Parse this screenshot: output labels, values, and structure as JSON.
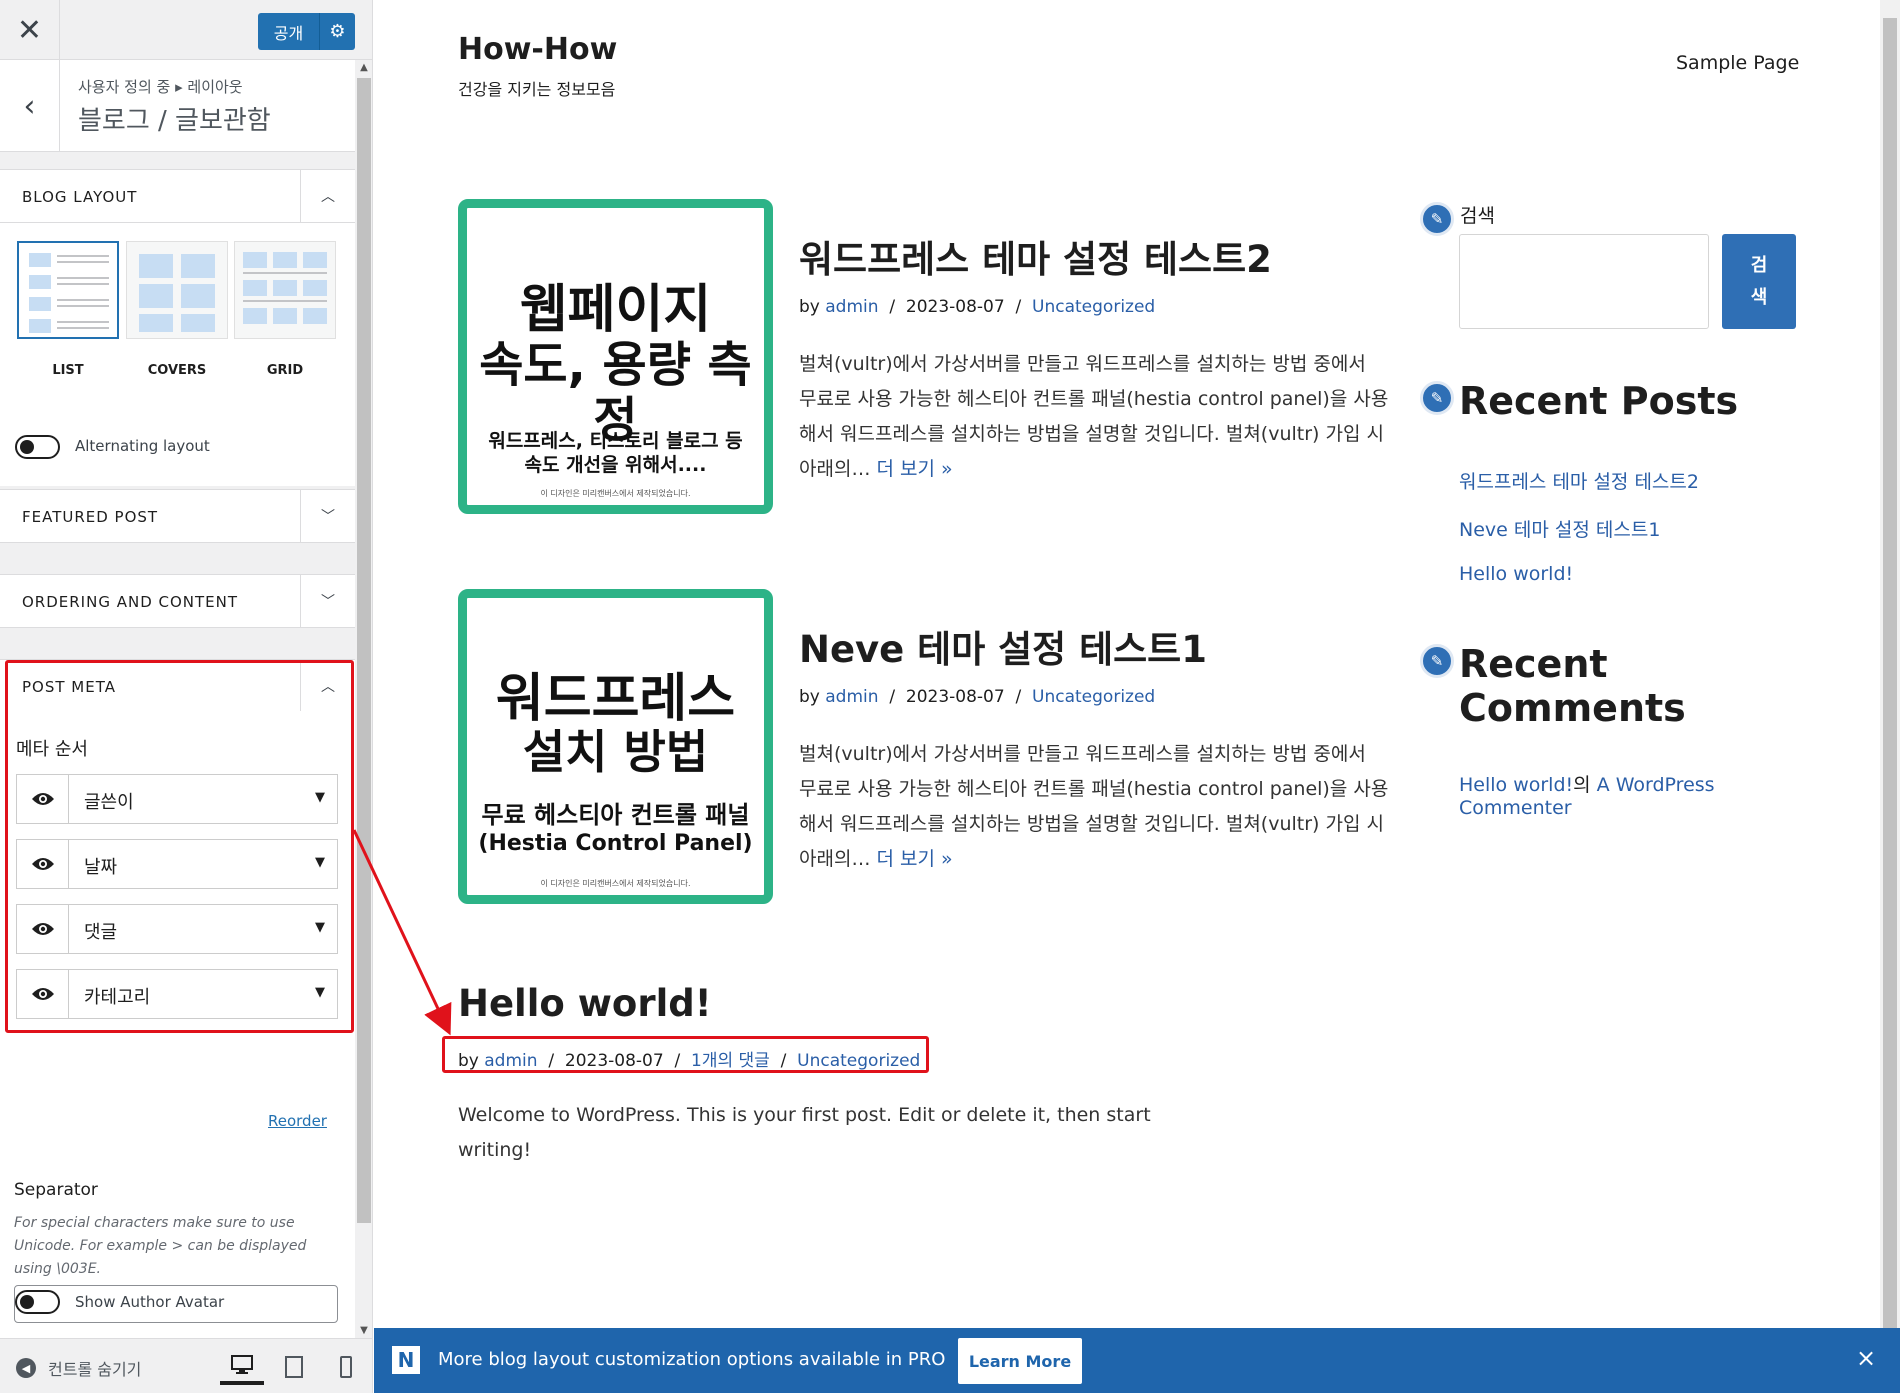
{
  "customizer": {
    "publish_label": "공개",
    "breadcrumb": "사용자 정의 중 ▸ 레이아웃",
    "section_title": "블로그 / 글보관함",
    "blog_layout": {
      "label": "BLOG LAYOUT",
      "options": [
        "LIST",
        "COVERS",
        "GRID"
      ],
      "selected": "LIST"
    },
    "alternating_layout": "Alternating layout",
    "featured_post": "FEATURED POST",
    "ordering_content": "ORDERING AND CONTENT",
    "post_meta": {
      "label": "POST META",
      "order_title": "메타 순서",
      "items": [
        "글쓴이",
        "날짜",
        "댓글",
        "카테고리"
      ],
      "reorder": "Reorder",
      "separator_title": "Separator",
      "separator_desc": "For special characters make sure to use Unicode. For example > can be displayed using \\003E.",
      "separator_value": "/",
      "show_author_avatar": "Show Author Avatar"
    },
    "hide_controls": "컨트롤 숨기기"
  },
  "preview": {
    "site_title": "How-How",
    "site_description": "건강을 지키는 정보모음",
    "nav": [
      "Sample Page"
    ],
    "posts": [
      {
        "title": "워드프레스 테마 설정 테스트2",
        "by": "by",
        "author": "admin",
        "date": "2023-08-07",
        "category": "Uncategorized",
        "excerpt": "벌쳐(vultr)에서 가상서버를 만들고 워드프레스를 설치하는 방법 중에서 무료로 사용 가능한 헤스티아 컨트롤 패널(hestia control panel)을 사용해서 워드프레스를 설치하는 방법을 설명할 것입니다. 벌쳐(vultr) 가입 시 아래의…",
        "read_more": "더 보기 »",
        "thumb": {
          "line1": "웹페이지",
          "line2": "속도, 용량 측정",
          "sub1": "워드프레스, 티스토리 블로그 등",
          "sub2": "속도 개선을 위해서....",
          "fine": "이 디자인은 미리캔버스에서 제작되었습니다."
        }
      },
      {
        "title": "Neve 테마 설정 테스트1",
        "by": "by",
        "author": "admin",
        "date": "2023-08-07",
        "category": "Uncategorized",
        "excerpt": "벌쳐(vultr)에서 가상서버를 만들고 워드프레스를 설치하는 방법 중에서 무료로 사용 가능한 헤스티아 컨트롤 패널(hestia control panel)을 사용해서 워드프레스를 설치하는 방법을 설명할 것입니다. 벌쳐(vultr) 가입 시 아래의…",
        "read_more": "더 보기 »",
        "thumb": {
          "line1": "워드프레스",
          "line2": "설치 방법",
          "sub1": "무료 헤스티아 컨트롤 패널",
          "sub2": "(Hestia Control Panel)",
          "fine": "이 디자인은 미리캔버스에서 제작되었습니다."
        }
      },
      {
        "title": "Hello world!",
        "by": "by",
        "author": "admin",
        "date": "2023-08-07",
        "comments": "1개의 댓글",
        "category": "Uncategorized",
        "excerpt": "Welcome to WordPress. This is your first post. Edit or delete it, then start writing!"
      }
    ],
    "sidebar": {
      "search_label": "검색",
      "search_button": "검\n색",
      "recent_posts_title": "Recent Posts",
      "recent_posts": [
        "워드프레스 테마 설정 테스트2",
        "Neve 테마 설정 테스트1",
        "Hello world!"
      ],
      "recent_comments_title": "Recent Comments",
      "recent_comment_post": "Hello world!",
      "recent_comment_sep": "의 ",
      "recent_comment_author": "A WordPress Commenter"
    }
  },
  "banner": {
    "logo": "N",
    "text": "More blog layout customization options available in PRO",
    "button": "Learn More",
    "close": "×"
  },
  "colors": {
    "wp_blue": "#2271b1",
    "thumb_border": "#2db387",
    "link": "#2a5ea7",
    "annotation_red": "#e0121b",
    "banner": "#1f65ac"
  }
}
